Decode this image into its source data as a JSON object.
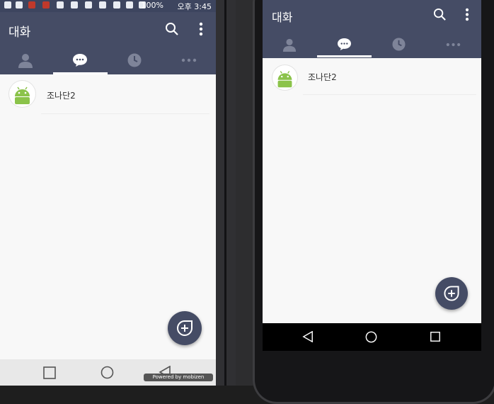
{
  "status_bar": {
    "battery": "100%",
    "time": "오후 3:45"
  },
  "left": {
    "title": "대화",
    "chat": {
      "name": "조나단2"
    },
    "watermark": "Powered by mobizen"
  },
  "right": {
    "title": "대화",
    "chat": {
      "name": "조나단2"
    }
  },
  "icons": {
    "search": "search-icon",
    "more": "more-vert-icon",
    "friends": "person-icon",
    "chats": "chat-bubble-icon",
    "recent": "clock-icon",
    "more_tab": "more-horiz-icon",
    "new_chat": "add-chat-icon",
    "recent_apps": "square-icon",
    "home": "circle-icon",
    "back": "back-triangle-icon"
  },
  "colors": {
    "header": "#454c65",
    "background": "#f8f8f8",
    "android_green": "#8bc34a"
  }
}
